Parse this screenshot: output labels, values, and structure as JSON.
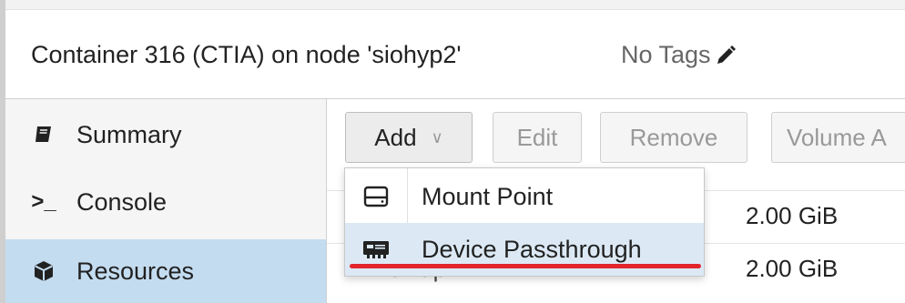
{
  "header": {
    "title": "Container 316 (CTIA) on node 'siohyp2'",
    "tags_label": "No Tags",
    "edit_icon": "pencil-icon"
  },
  "sidebar": {
    "items": [
      {
        "label": "Summary",
        "icon": "book-icon",
        "active": false
      },
      {
        "label": "Console",
        "icon": "terminal-icon",
        "active": false
      },
      {
        "label": "Resources",
        "icon": "cube-icon",
        "active": true
      }
    ]
  },
  "toolbar": {
    "add_label": "Add",
    "edit_label": "Edit",
    "remove_label": "Remove",
    "volume_label": "Volume A"
  },
  "grid": {
    "rows": [
      {
        "value": "2.00 GiB"
      },
      {
        "label": "Swap",
        "value": "2.00 GiB"
      }
    ]
  },
  "dropdown": {
    "items": [
      {
        "label": "Mount Point",
        "icon": "hdd-icon"
      },
      {
        "label": "Device Passthrough",
        "icon": "device-icon",
        "hover": true
      }
    ]
  },
  "colors": {
    "active_nav": "#c4dcf0",
    "hover_menu": "#dce9f5",
    "annotation_underline": "#e2262c"
  }
}
